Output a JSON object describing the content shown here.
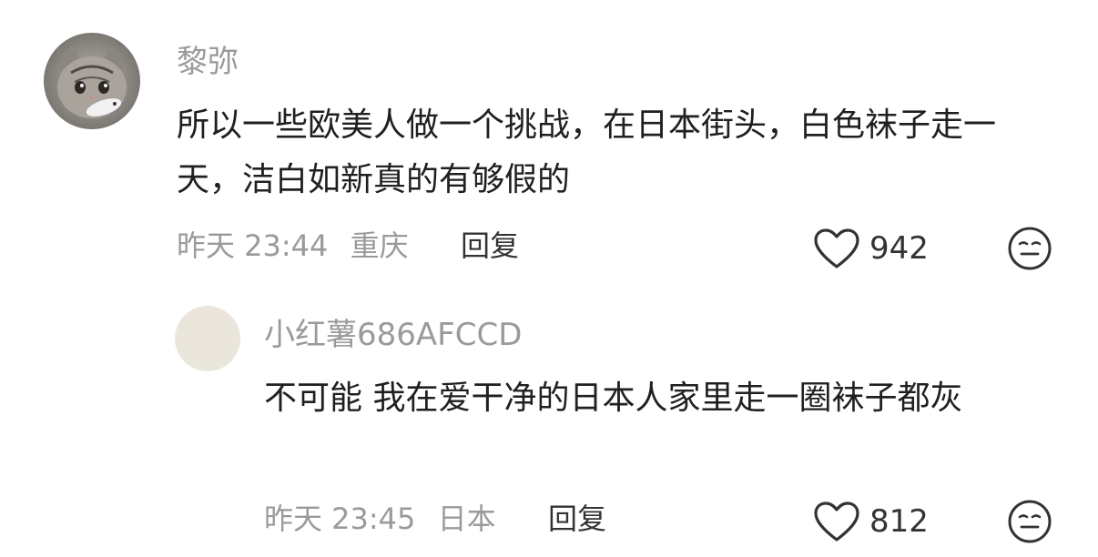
{
  "comments": [
    {
      "username": "黎弥",
      "text": "所以一些欧美人做一个挑战，在日本街头，白色袜子走一天，洁白如新真的有够假的",
      "time": "昨天 23:44",
      "location": "重庆",
      "reply_label": "回复",
      "like_count": "942",
      "avatar_icon": "cat-avatar-icon"
    },
    {
      "username": "小红薯686AFCCD",
      "text": "不可能 我在爱干净的日本人家里走一圈袜子都灰",
      "time": "昨天 23:45",
      "location": "日本",
      "reply_label": "回复",
      "like_count": "812",
      "avatar_icon": "default-avatar-icon"
    }
  ],
  "icons": {
    "like": "heart-outline-icon",
    "reaction": "neutral-face-icon"
  },
  "colors": {
    "meta": "#9a9a9a",
    "text": "#202020",
    "avatar_default": "#ebe6dc"
  }
}
